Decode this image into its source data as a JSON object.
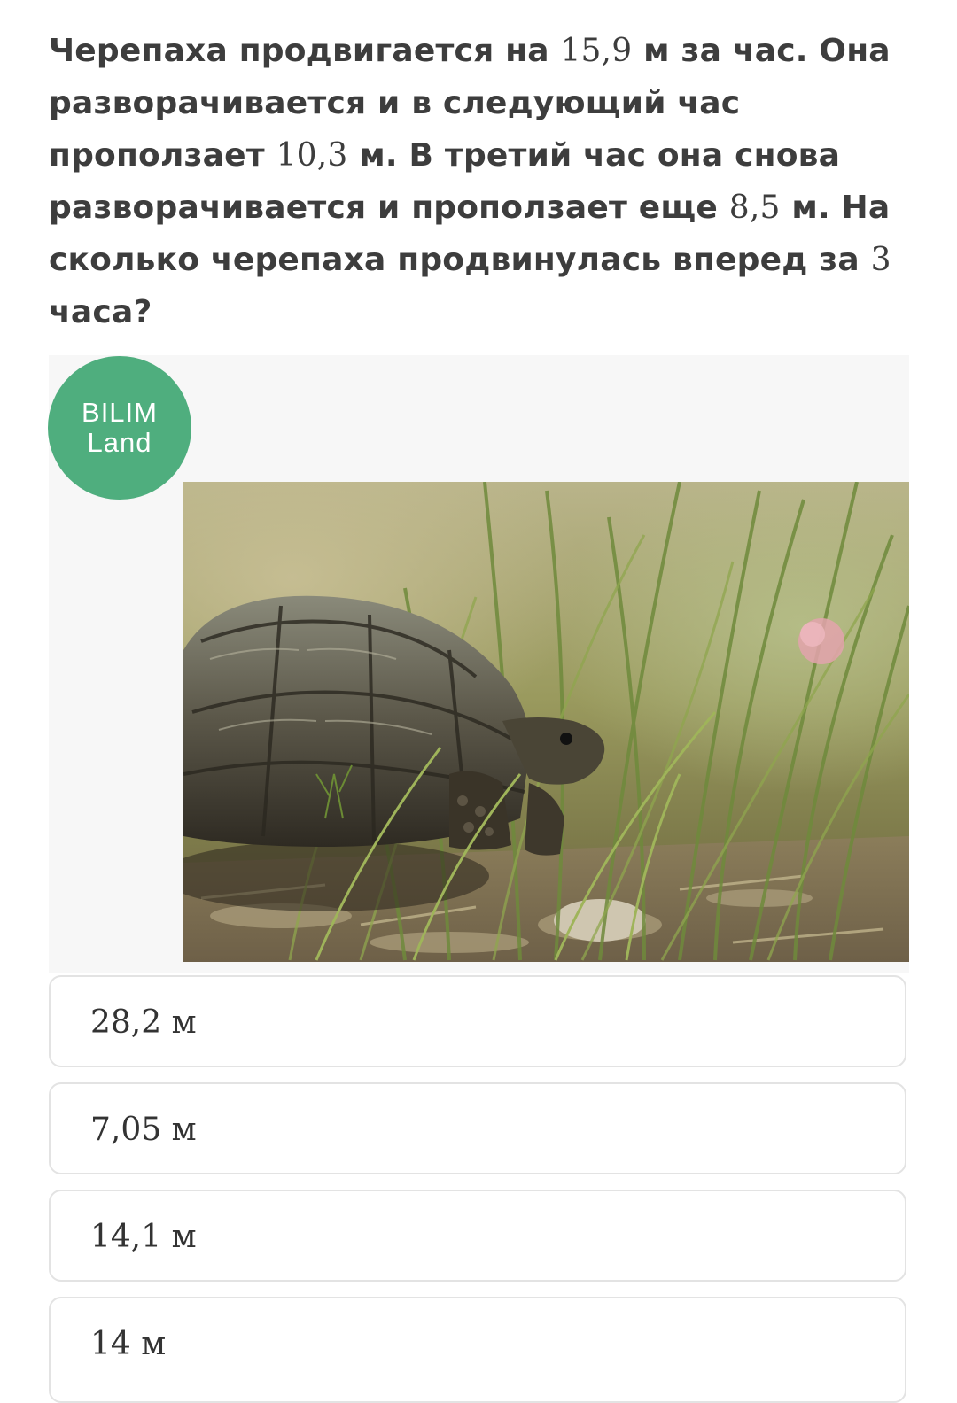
{
  "question": {
    "part1": "Черепаха продвигается на ",
    "num1": "15,9",
    "part2": " м за час. Она разворачивается и в следующий час проползает ",
    "num2": "10,3",
    "part3": " м. В третий час она снова разворачивается и проползает еще ",
    "num3": "8,5",
    "part4": " м. На сколько черепаха продвинулась вперед за ",
    "num4": "3",
    "part5": " часа?"
  },
  "logo": {
    "line1": "BILIM",
    "line2": "Land",
    "color": "#4fae7e"
  },
  "photo": {
    "icon": "tortoise-photo"
  },
  "options": [
    {
      "value": "28,2",
      "unit": " м"
    },
    {
      "value": "7,05",
      "unit": " м"
    },
    {
      "value": "14,1",
      "unit": " м"
    },
    {
      "value": "14",
      "unit": " м"
    }
  ]
}
